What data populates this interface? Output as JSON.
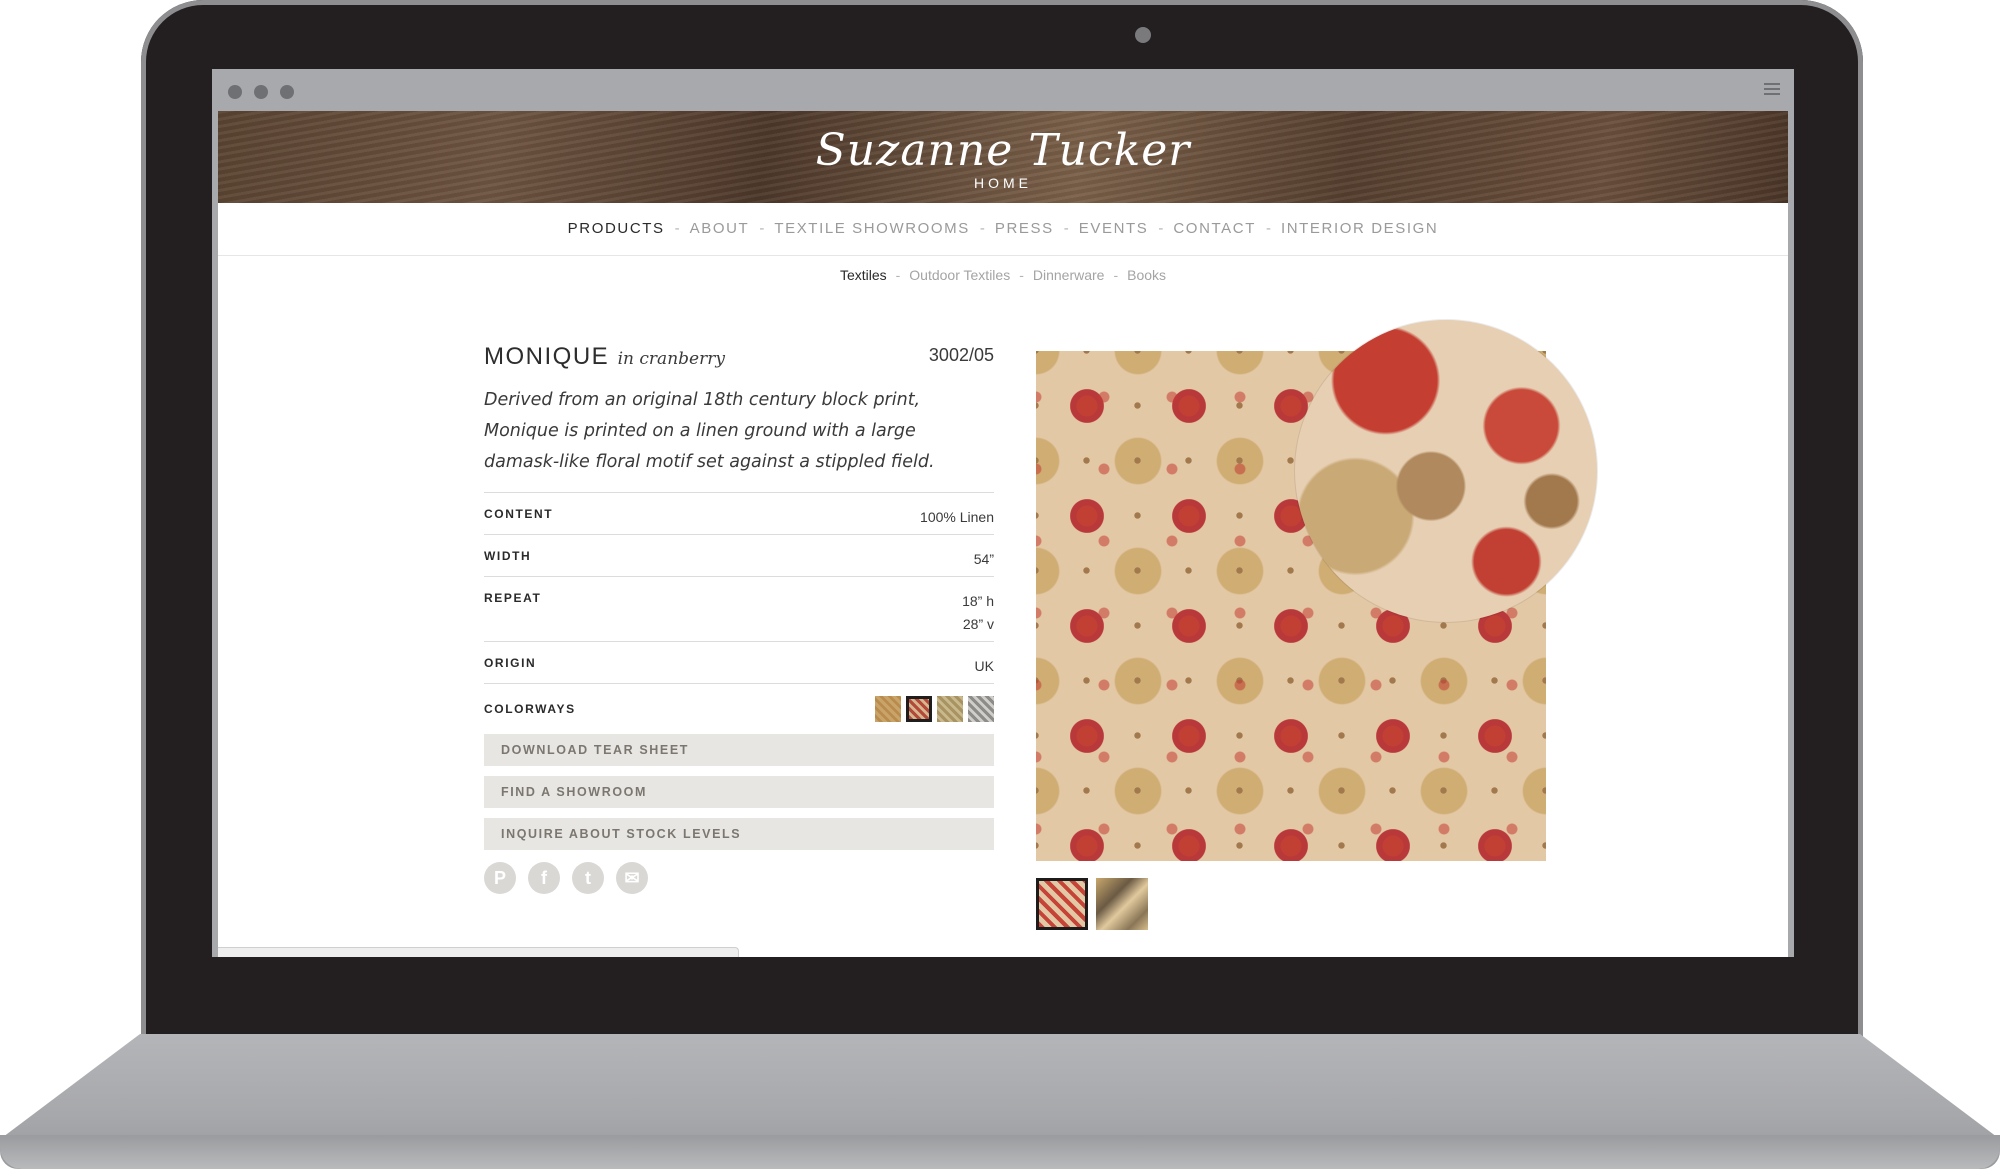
{
  "brand": {
    "script": "Suzanne Tucker",
    "sub": "HOME"
  },
  "nav": {
    "items": [
      {
        "label": "PRODUCTS"
      },
      {
        "label": "ABOUT"
      },
      {
        "label": "TEXTILE SHOWROOMS"
      },
      {
        "label": "PRESS"
      },
      {
        "label": "EVENTS"
      },
      {
        "label": "CONTACT"
      },
      {
        "label": "INTERIOR DESIGN"
      }
    ],
    "separator": "-",
    "active": "PRODUCTS"
  },
  "subnav": {
    "items": [
      {
        "label": "Textiles"
      },
      {
        "label": "Outdoor Textiles"
      },
      {
        "label": "Dinnerware"
      },
      {
        "label": "Books"
      }
    ],
    "separator": "-",
    "active": "Textiles"
  },
  "product": {
    "name": "MONIQUE",
    "colorway": "in cranberry",
    "sku": "3002/05",
    "description": "Derived from an original 18th century block print, Monique is printed on a linen ground with a large damask-like floral motif set against a stippled field.",
    "specs": {
      "content": {
        "label": "CONTENT",
        "value": "100% Linen"
      },
      "width": {
        "label": "WIDTH",
        "value": "54”"
      },
      "repeat": {
        "label": "REPEAT",
        "h": "18” h",
        "v": "28” v"
      },
      "origin": {
        "label": "ORIGIN",
        "value": "UK"
      },
      "colorways": {
        "label": "COLORWAYS"
      }
    },
    "colorway_swatches": [
      {
        "name": "gold",
        "color": "#c9a46a"
      },
      {
        "name": "cranberry",
        "color": "#b14a3b",
        "selected": true
      },
      {
        "name": "olive",
        "color": "#a89363"
      },
      {
        "name": "grey",
        "color": "#8e8c89"
      }
    ]
  },
  "actions": {
    "download": "DOWNLOAD TEAR SHEET",
    "showroom": "FIND A SHOWROOM",
    "inquire": "INQUIRE ABOUT STOCK LEVELS"
  },
  "social": {
    "pinterest": "P",
    "facebook": "f",
    "twitter": "t",
    "email": "✉"
  },
  "icons": [
    "pinterest-icon",
    "facebook-icon",
    "twitter-icon",
    "email-icon",
    "hamburger-menu-icon"
  ],
  "colors": {
    "header_brown": "#5a4331",
    "button_bg": "#e8e6e3",
    "accent_red": "#c23f33"
  }
}
